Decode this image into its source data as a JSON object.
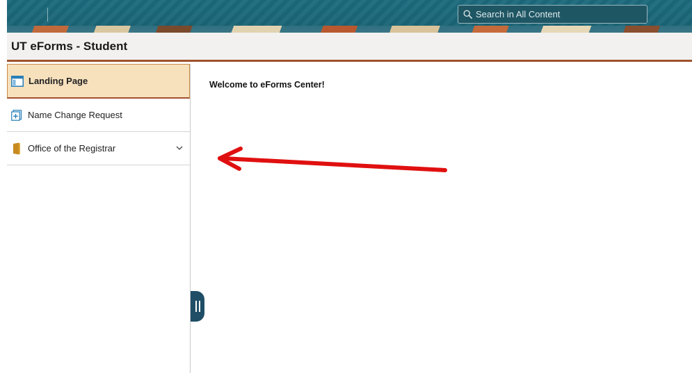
{
  "banner": {
    "search_placeholder": "Search in All Content"
  },
  "titlebar": {
    "title": "UT eForms - Student"
  },
  "sidebar": {
    "items": [
      {
        "label": "Landing Page",
        "icon": "landing-page-icon",
        "active": true
      },
      {
        "label": "Name Change Request",
        "icon": "form-add-icon",
        "active": false
      },
      {
        "label": "Office of the Registrar",
        "icon": "folder-icon",
        "active": false,
        "expandable": true
      }
    ]
  },
  "main": {
    "welcome_text": "Welcome to eForms Center!"
  },
  "annotation": {
    "arrow_color": "#e01010"
  },
  "colors": {
    "banner": "#1c6b7d",
    "accent": "#a0522d",
    "active_item_bg": "#f7e1bd",
    "collapse_handle": "#1f4e66"
  }
}
